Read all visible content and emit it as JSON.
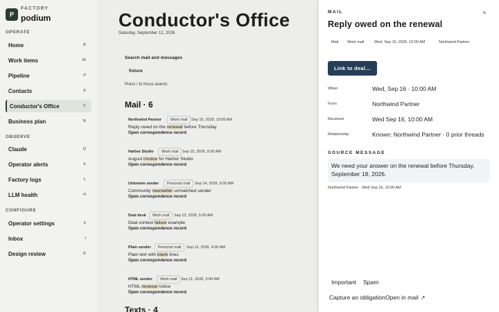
{
  "brand": {
    "logo_letter": "P",
    "org": "FACTORY",
    "app": "podium"
  },
  "sidebar": {
    "sections": [
      {
        "label": "OPERATE"
      },
      {
        "label": "OBSERVE"
      },
      {
        "label": "CONFIGURE"
      }
    ],
    "items": [
      {
        "label": "Home",
        "key": "R"
      },
      {
        "label": "Work items",
        "key": "W"
      },
      {
        "label": "Pipeline",
        "key": "P"
      },
      {
        "label": "Contacts",
        "key": "E"
      },
      {
        "label": "Conductor's Office",
        "key": "C"
      },
      {
        "label": "Business plan",
        "key": "B"
      },
      {
        "label": "Claude",
        "key": "Q"
      },
      {
        "label": "Operator alerts",
        "key": "A"
      },
      {
        "label": "Factory logs",
        "key": "L"
      },
      {
        "label": "LLM health",
        "key": "H"
      },
      {
        "label": "Operator settings",
        "key": "S"
      },
      {
        "label": "Inbox",
        "key": "I"
      },
      {
        "label": "Design review",
        "key": "D"
      }
    ]
  },
  "main": {
    "title": "Conductor's Office",
    "date": "Saturday, September 12, 2026",
    "search": {
      "label": "Search mail and messages",
      "value": "fixture",
      "hint": "Press / to focus search."
    },
    "mail_heading": "Mail · 6",
    "texts_heading": "Texts · 4",
    "open_link": "Open correspondence record",
    "mail": [
      {
        "sender": "Northwind Partner",
        "tag": "Work mail",
        "time": "Sep 16, 2026, 10:00 AM",
        "pre": "Reply owed on the ",
        "hl": "renewal",
        "post": " before Thursday"
      },
      {
        "sender": "Harbor Studio",
        "tag": "Work mail",
        "time": "Sep 15, 2026, 9:30 AM",
        "pre": "August ",
        "hl": "invoice",
        "post": " for Harbor Studio"
      },
      {
        "sender": "Unknown sender",
        "tag": "Personal mail",
        "time": "Sep 14, 2026, 6:00 AM",
        "pre": "Community ",
        "hl": "newsletter",
        "post": " unmatched sender"
      },
      {
        "sender": "Deal desk",
        "tag": "Work mail",
        "time": "Sep 13, 2026, 5:00 AM",
        "pre": "Deal context ",
        "hl": "failure",
        "post": " example"
      },
      {
        "sender": "Plain sender",
        "tag": "Personal mail",
        "time": "Sep 12, 2026, 4:00 AM",
        "pre": "Plain text with ",
        "hl": "blank",
        "post": " lines"
      },
      {
        "sender": "HTML sender",
        "tag": "Work mail",
        "time": "Sep 11, 2026, 3:00 AM",
        "pre": "HTML ",
        "hl": "renewal",
        "post": " notice"
      }
    ]
  },
  "panel": {
    "eyebrow": "MAIL",
    "title": "Reply owed on the renewal",
    "close_icon": "×",
    "meta": [
      "Mail",
      "Work mail",
      "Wed, Sep 16, 2026, 10:00 AM",
      "Northwind Partner"
    ],
    "primary_button": "Link to deal…",
    "fields": [
      {
        "label": "When",
        "value": "Wed, Sep 16 · 10:00 AM"
      },
      {
        "label": "From",
        "value": "Northwind Partner"
      },
      {
        "label": "Received",
        "value": "Wed Sep 16, 10:00 AM"
      },
      {
        "label": "Relationship",
        "value": "Known: Northwind Partner · 0 prior threads"
      }
    ],
    "source_eyebrow": "SOURCE MESSAGE",
    "source_text": "We need your answer on the renewal before Thursday, September 18, 2026.",
    "source_meta": "Northwind Partner · Wed Sep 16, 10:00 AM",
    "tabs": [
      "Important",
      "Spam"
    ],
    "actions": {
      "capture": "Capture an obligation",
      "open": "Open in mail",
      "open_icon": "↗"
    }
  }
}
